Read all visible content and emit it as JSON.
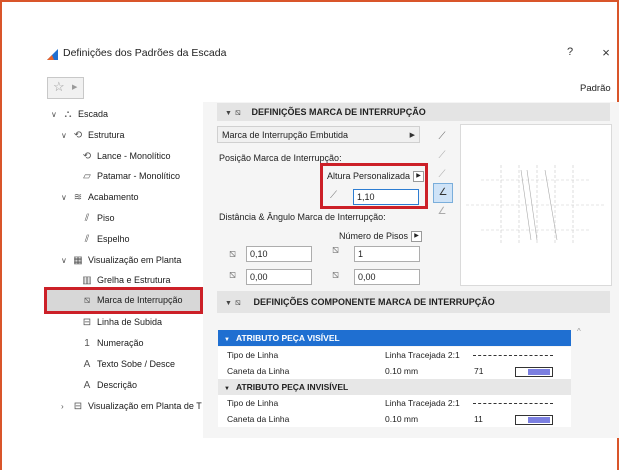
{
  "window": {
    "title": "Definições dos Padrões da Escada",
    "help_label": "?",
    "close_label": "×",
    "favorite_icon": "star-icon",
    "preset_label": "Padrão"
  },
  "tree": {
    "items": [
      {
        "label": "Escada"
      },
      {
        "label": "Estrutura"
      },
      {
        "label": "Lance - Monolítico"
      },
      {
        "label": "Patamar - Monolítico"
      },
      {
        "label": "Acabamento"
      },
      {
        "label": "Piso"
      },
      {
        "label": "Espelho"
      },
      {
        "label": "Visualização em Planta"
      },
      {
        "label": "Grelha e Estrutura"
      },
      {
        "label": "Marca de Interrupção"
      },
      {
        "label": "Linha de Subida"
      },
      {
        "label": "Numeração"
      },
      {
        "label": "Texto Sobe / Desce"
      },
      {
        "label": "Descrição"
      },
      {
        "label": "Visualização em Planta de T"
      }
    ]
  },
  "break_mark": {
    "header": "DEFINIÇÕES MARCA DE INTERRUPÇÃO",
    "type_value": "Marca de Interrupção Embutida",
    "position_label": "Posição Marca de Interrupção:",
    "height_mode": "Altura Personalizada",
    "height_value": "1,10",
    "distance_label": "Distância & Ângulo Marca de Interrupção:",
    "floors_mode": "Número de Pisos",
    "field_a": "0,10",
    "field_b": "1",
    "field_c": "0,00",
    "field_d": "0,00"
  },
  "component": {
    "header": "DEFINIÇÕES COMPONENTE MARCA DE INTERRUPÇÃO",
    "visible_header": "ATRIBUTO PEÇA VISÍVEL",
    "invisible_header": "ATRIBUTO PEÇA INVISÍVEL",
    "visible_rows": [
      {
        "name": "Tipo de Linha",
        "value": "Linha Tracejada 2:1",
        "extra": ""
      },
      {
        "name": "Caneta da Linha",
        "value": "0.10 mm",
        "extra": "71"
      }
    ],
    "invisible_rows": [
      {
        "name": "Tipo de Linha",
        "value": "Linha Tracejada 2:1",
        "extra": ""
      },
      {
        "name": "Caneta da Linha",
        "value": "0.10 mm",
        "extra": "11"
      }
    ]
  },
  "colors": {
    "highlight_red": "#cc2028",
    "selection_blue": "#1f6fd1",
    "pen_swatch": "#7b7fe0"
  }
}
